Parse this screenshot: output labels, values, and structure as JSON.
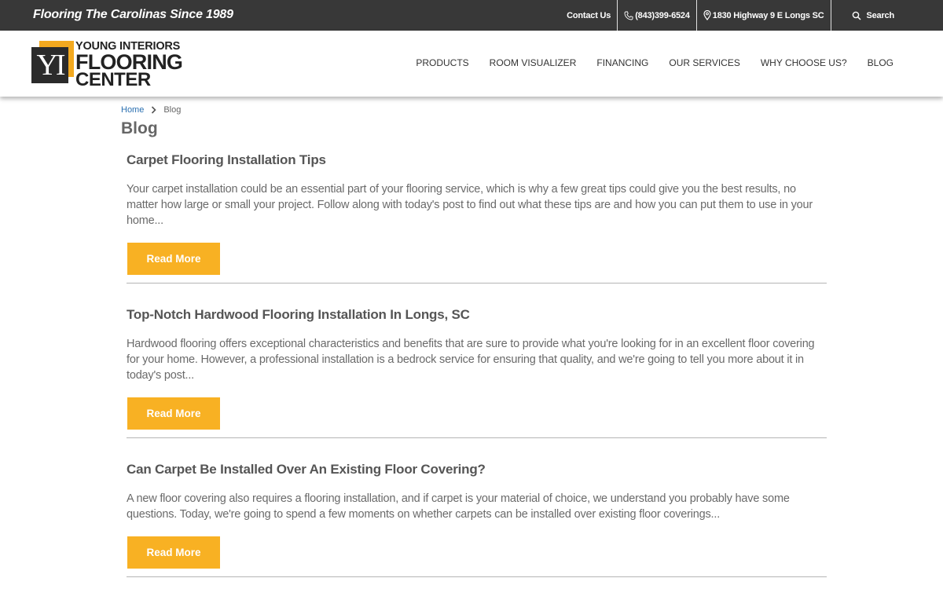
{
  "topbar": {
    "tagline": "Flooring The Carolinas Since 1989",
    "contact": "Contact Us",
    "phone": "(843)399-6524",
    "address": "1830 Highway 9 E Longs SC",
    "search": "Search"
  },
  "logo": {
    "mark": "YI",
    "line1": "YOUNG INTERIORS",
    "line2": "FLOORING",
    "line3": "CENTER"
  },
  "nav": [
    "PRODUCTS",
    "ROOM VISUALIZER",
    "FINANCING",
    "OUR SERVICES",
    "WHY CHOOSE US?",
    "BLOG"
  ],
  "breadcrumb": {
    "home": "Home",
    "current": "Blog"
  },
  "page_title": "Blog",
  "posts": [
    {
      "title": "Carpet Flooring Installation Tips",
      "excerpt": "Your carpet installation could be an essential part of your flooring service, which is why a few great tips could give you the best results, no matter how large or small your project. Follow along with today's post to find out what these tips are and how you can put them to use in your home...",
      "button": "Read More"
    },
    {
      "title": "Top-Notch Hardwood Flooring Installation In Longs, SC",
      "excerpt": "Hardwood flooring offers exceptional characteristics and benefits that are sure to provide what you're looking for in an excellent floor covering for your home. However, a professional installation is a bedrock service for ensuring that quality, and we're going to tell you more about it in today's post...",
      "button": "Read More"
    },
    {
      "title": "Can Carpet Be Installed Over An Existing Floor Covering?",
      "excerpt": "A new floor covering also requires a flooring installation, and if carpet is your material of choice, we understand you probably have some questions. Today, we're going to spend a few moments on whether carpets can be installed over existing floor coverings...",
      "button": "Read More"
    }
  ],
  "colors": {
    "topbar": "#383838",
    "accent": "#f8b123",
    "link": "#2a6fb0"
  }
}
